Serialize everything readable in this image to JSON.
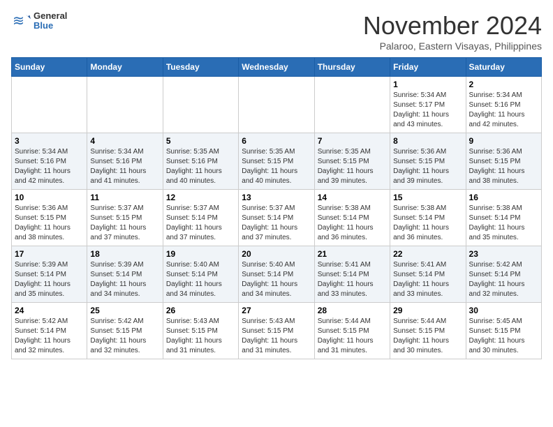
{
  "header": {
    "logo_general": "General",
    "logo_blue": "Blue",
    "month_title": "November 2024",
    "location": "Palaroo, Eastern Visayas, Philippines"
  },
  "calendar": {
    "days_of_week": [
      "Sunday",
      "Monday",
      "Tuesday",
      "Wednesday",
      "Thursday",
      "Friday",
      "Saturday"
    ],
    "weeks": [
      [
        {
          "day": "",
          "info": ""
        },
        {
          "day": "",
          "info": ""
        },
        {
          "day": "",
          "info": ""
        },
        {
          "day": "",
          "info": ""
        },
        {
          "day": "",
          "info": ""
        },
        {
          "day": "1",
          "info": "Sunrise: 5:34 AM\nSunset: 5:17 PM\nDaylight: 11 hours\nand 43 minutes."
        },
        {
          "day": "2",
          "info": "Sunrise: 5:34 AM\nSunset: 5:16 PM\nDaylight: 11 hours\nand 42 minutes."
        }
      ],
      [
        {
          "day": "3",
          "info": "Sunrise: 5:34 AM\nSunset: 5:16 PM\nDaylight: 11 hours\nand 42 minutes."
        },
        {
          "day": "4",
          "info": "Sunrise: 5:34 AM\nSunset: 5:16 PM\nDaylight: 11 hours\nand 41 minutes."
        },
        {
          "day": "5",
          "info": "Sunrise: 5:35 AM\nSunset: 5:16 PM\nDaylight: 11 hours\nand 40 minutes."
        },
        {
          "day": "6",
          "info": "Sunrise: 5:35 AM\nSunset: 5:15 PM\nDaylight: 11 hours\nand 40 minutes."
        },
        {
          "day": "7",
          "info": "Sunrise: 5:35 AM\nSunset: 5:15 PM\nDaylight: 11 hours\nand 39 minutes."
        },
        {
          "day": "8",
          "info": "Sunrise: 5:36 AM\nSunset: 5:15 PM\nDaylight: 11 hours\nand 39 minutes."
        },
        {
          "day": "9",
          "info": "Sunrise: 5:36 AM\nSunset: 5:15 PM\nDaylight: 11 hours\nand 38 minutes."
        }
      ],
      [
        {
          "day": "10",
          "info": "Sunrise: 5:36 AM\nSunset: 5:15 PM\nDaylight: 11 hours\nand 38 minutes."
        },
        {
          "day": "11",
          "info": "Sunrise: 5:37 AM\nSunset: 5:15 PM\nDaylight: 11 hours\nand 37 minutes."
        },
        {
          "day": "12",
          "info": "Sunrise: 5:37 AM\nSunset: 5:14 PM\nDaylight: 11 hours\nand 37 minutes."
        },
        {
          "day": "13",
          "info": "Sunrise: 5:37 AM\nSunset: 5:14 PM\nDaylight: 11 hours\nand 37 minutes."
        },
        {
          "day": "14",
          "info": "Sunrise: 5:38 AM\nSunset: 5:14 PM\nDaylight: 11 hours\nand 36 minutes."
        },
        {
          "day": "15",
          "info": "Sunrise: 5:38 AM\nSunset: 5:14 PM\nDaylight: 11 hours\nand 36 minutes."
        },
        {
          "day": "16",
          "info": "Sunrise: 5:38 AM\nSunset: 5:14 PM\nDaylight: 11 hours\nand 35 minutes."
        }
      ],
      [
        {
          "day": "17",
          "info": "Sunrise: 5:39 AM\nSunset: 5:14 PM\nDaylight: 11 hours\nand 35 minutes."
        },
        {
          "day": "18",
          "info": "Sunrise: 5:39 AM\nSunset: 5:14 PM\nDaylight: 11 hours\nand 34 minutes."
        },
        {
          "day": "19",
          "info": "Sunrise: 5:40 AM\nSunset: 5:14 PM\nDaylight: 11 hours\nand 34 minutes."
        },
        {
          "day": "20",
          "info": "Sunrise: 5:40 AM\nSunset: 5:14 PM\nDaylight: 11 hours\nand 34 minutes."
        },
        {
          "day": "21",
          "info": "Sunrise: 5:41 AM\nSunset: 5:14 PM\nDaylight: 11 hours\nand 33 minutes."
        },
        {
          "day": "22",
          "info": "Sunrise: 5:41 AM\nSunset: 5:14 PM\nDaylight: 11 hours\nand 33 minutes."
        },
        {
          "day": "23",
          "info": "Sunrise: 5:42 AM\nSunset: 5:14 PM\nDaylight: 11 hours\nand 32 minutes."
        }
      ],
      [
        {
          "day": "24",
          "info": "Sunrise: 5:42 AM\nSunset: 5:14 PM\nDaylight: 11 hours\nand 32 minutes."
        },
        {
          "day": "25",
          "info": "Sunrise: 5:42 AM\nSunset: 5:15 PM\nDaylight: 11 hours\nand 32 minutes."
        },
        {
          "day": "26",
          "info": "Sunrise: 5:43 AM\nSunset: 5:15 PM\nDaylight: 11 hours\nand 31 minutes."
        },
        {
          "day": "27",
          "info": "Sunrise: 5:43 AM\nSunset: 5:15 PM\nDaylight: 11 hours\nand 31 minutes."
        },
        {
          "day": "28",
          "info": "Sunrise: 5:44 AM\nSunset: 5:15 PM\nDaylight: 11 hours\nand 31 minutes."
        },
        {
          "day": "29",
          "info": "Sunrise: 5:44 AM\nSunset: 5:15 PM\nDaylight: 11 hours\nand 30 minutes."
        },
        {
          "day": "30",
          "info": "Sunrise: 5:45 AM\nSunset: 5:15 PM\nDaylight: 11 hours\nand 30 minutes."
        }
      ]
    ]
  }
}
